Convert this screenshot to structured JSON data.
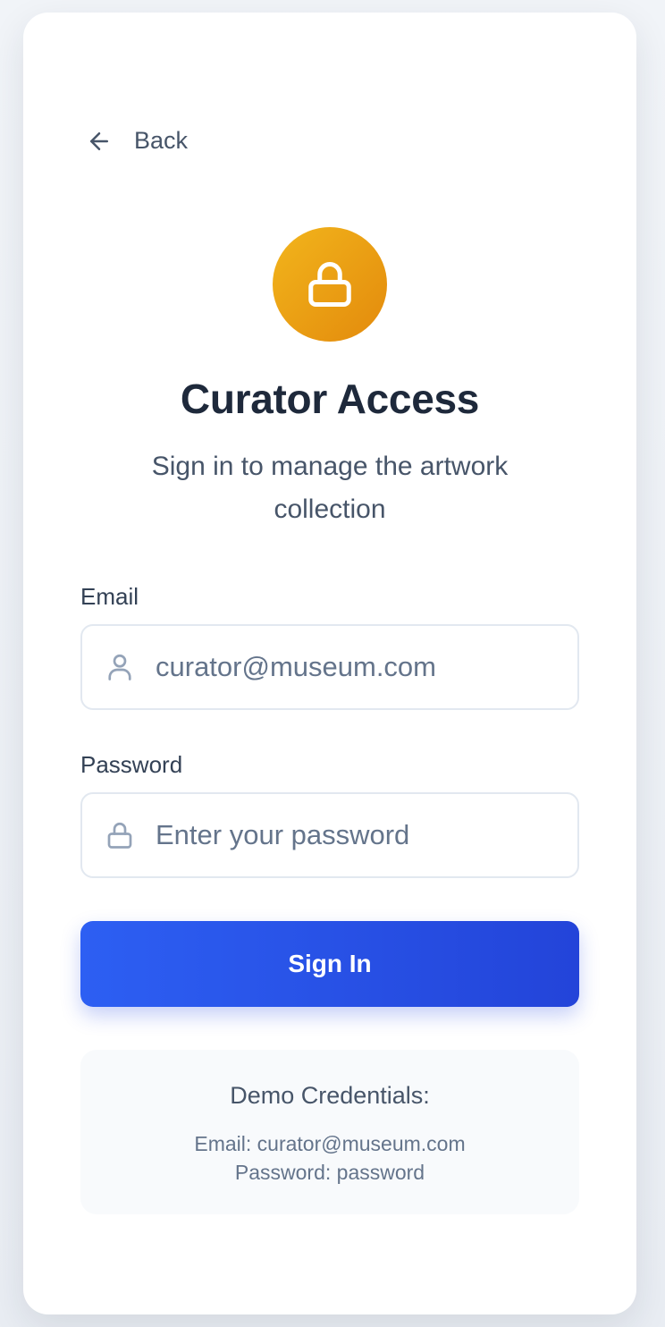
{
  "nav": {
    "back_label": "Back",
    "back_icon": "arrow-left-icon"
  },
  "header": {
    "badge_icon": "lock-icon",
    "title": "Curator Access",
    "subtitle": "Sign in to manage the artwork collection"
  },
  "form": {
    "email": {
      "label": "Email",
      "icon": "user-icon",
      "placeholder": "curator@museum.com",
      "value": ""
    },
    "password": {
      "label": "Password",
      "icon": "lock-icon",
      "placeholder": "Enter your password",
      "value": ""
    },
    "submit_label": "Sign In"
  },
  "demo": {
    "title": "Demo Credentials:",
    "email_line": "Email: curator@museum.com",
    "password_line": "Password: password"
  },
  "colors": {
    "badge_gradient_start": "#f2b51c",
    "badge_gradient_end": "#e38a0c",
    "button_gradient_start": "#2d5ff3",
    "button_gradient_end": "#2344d9",
    "title_text": "#1e293b",
    "body_text": "#475569"
  }
}
